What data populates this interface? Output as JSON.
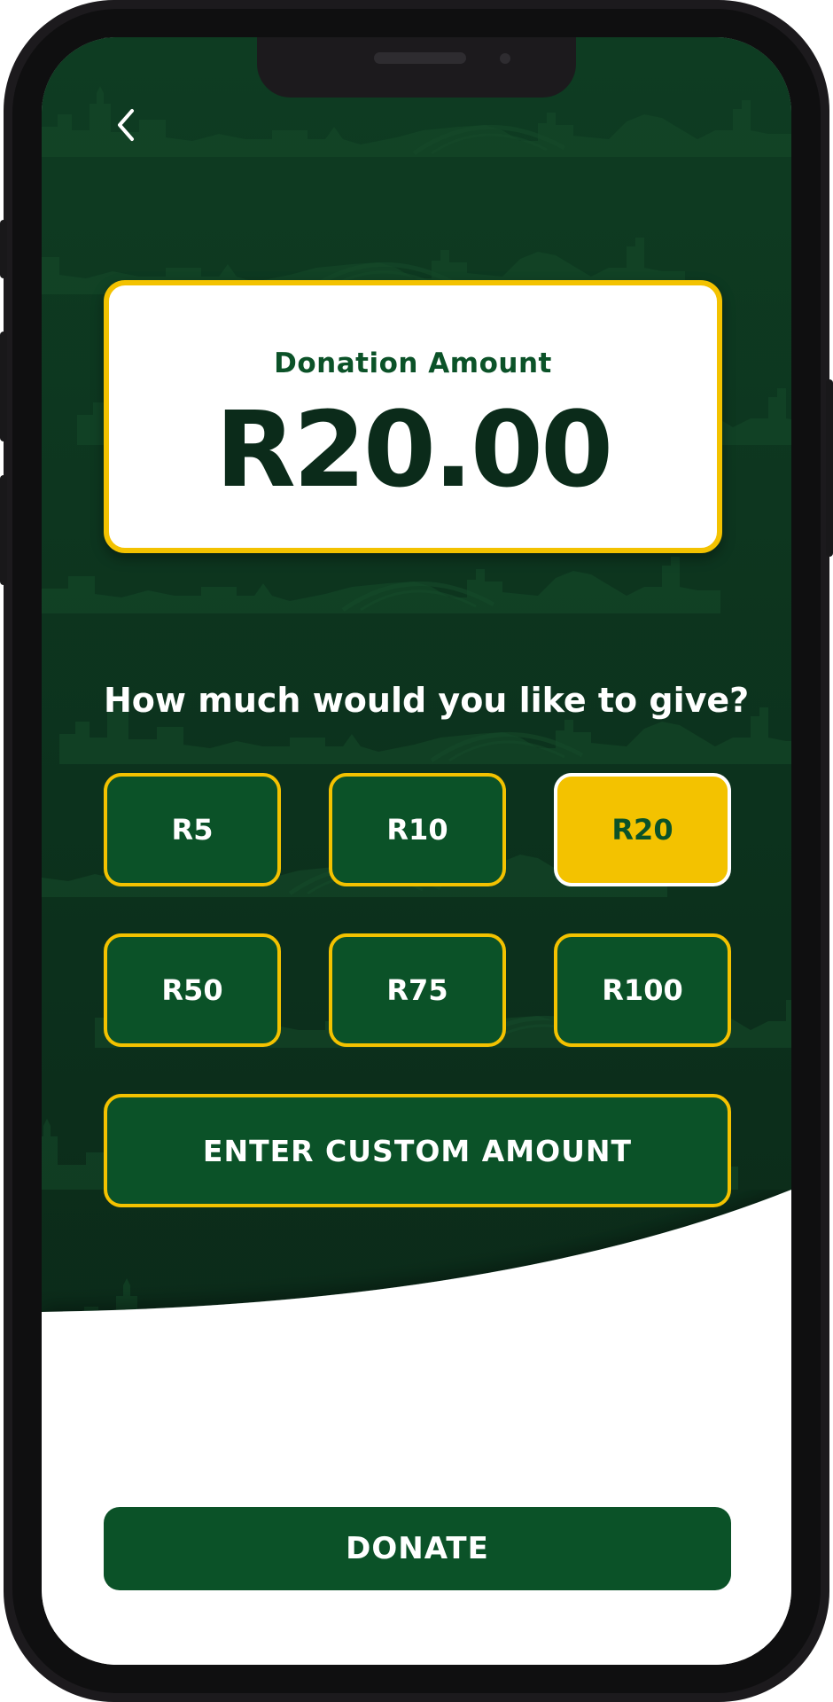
{
  "app": {
    "back_icon": "chevron-left-icon"
  },
  "amount_card": {
    "label": "Donation Amount",
    "value": "R20.00"
  },
  "question": "How much would you like to give?",
  "amount_options": [
    {
      "label": "R5",
      "selected": false
    },
    {
      "label": "R10",
      "selected": false
    },
    {
      "label": "R20",
      "selected": true
    },
    {
      "label": "R50",
      "selected": false
    },
    {
      "label": "R75",
      "selected": false
    },
    {
      "label": "R100",
      "selected": false
    }
  ],
  "custom_amount_label": "ENTER CUSTOM AMOUNT",
  "donate_label": "DONATE",
  "colors": {
    "brand_green": "#0b5228",
    "background_green": "#0c301c",
    "accent_yellow": "#f3c200",
    "amount_text": "#0b2b1a"
  }
}
